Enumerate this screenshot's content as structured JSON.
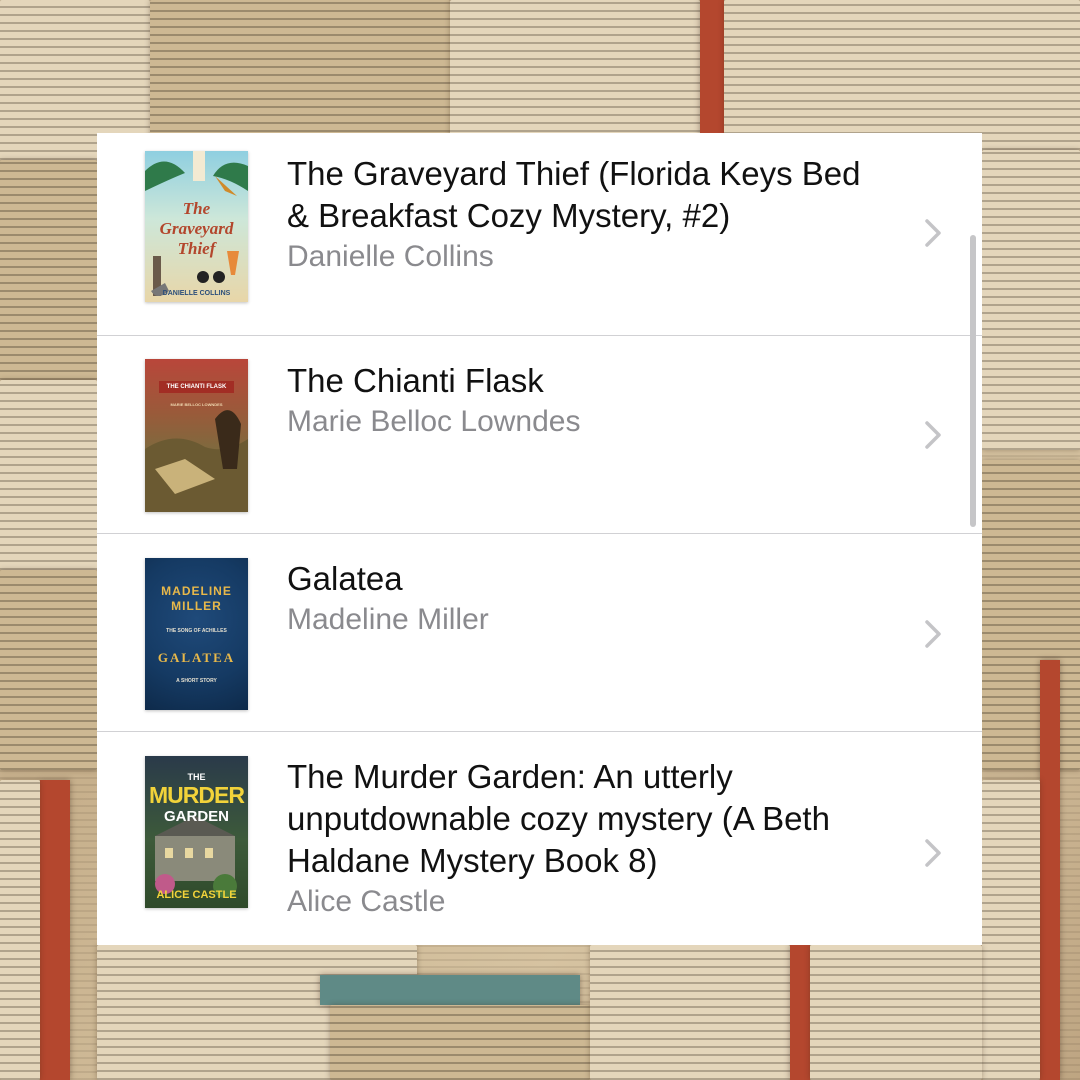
{
  "books": [
    {
      "title": "The Graveyard Thief (Florida Keys Bed & Breakfast Cozy Mystery, #2)",
      "author": "Danielle Collins",
      "cover_title": "The Graveyard Thief",
      "cover_author": "DANIELLE COLLINS",
      "icon": "chevron-right-icon"
    },
    {
      "title": "The Chianti Flask",
      "author": "Marie Belloc Lowndes",
      "cover_title": "THE CHIANTI FLASK",
      "cover_author": "MARIE BELLOC LOWNDES",
      "icon": "chevron-right-icon"
    },
    {
      "title": "Galatea",
      "author": "Madeline Miller",
      "cover_title": "GALATEA",
      "cover_author": "MADELINE MILLER",
      "cover_blurb": "THE SONG OF ACHILLES",
      "cover_note": "A SHORT STORY",
      "icon": "chevron-right-icon"
    },
    {
      "title": "The Murder Garden: An utterly unputdownable cozy mystery (A Beth Haldane Mystery Book 8)",
      "author": "Alice Castle",
      "cover_title_1": "THE",
      "cover_title_2": "MURDER",
      "cover_title_3": "GARDEN",
      "cover_author": "ALICE CASTLE",
      "icon": "chevron-right-icon"
    }
  ],
  "colors": {
    "panel": "#ffffff",
    "title_text": "#111111",
    "author_text": "#8a8a8e",
    "chevron": "#c4c4c7",
    "separator": "#d1d1d4"
  }
}
